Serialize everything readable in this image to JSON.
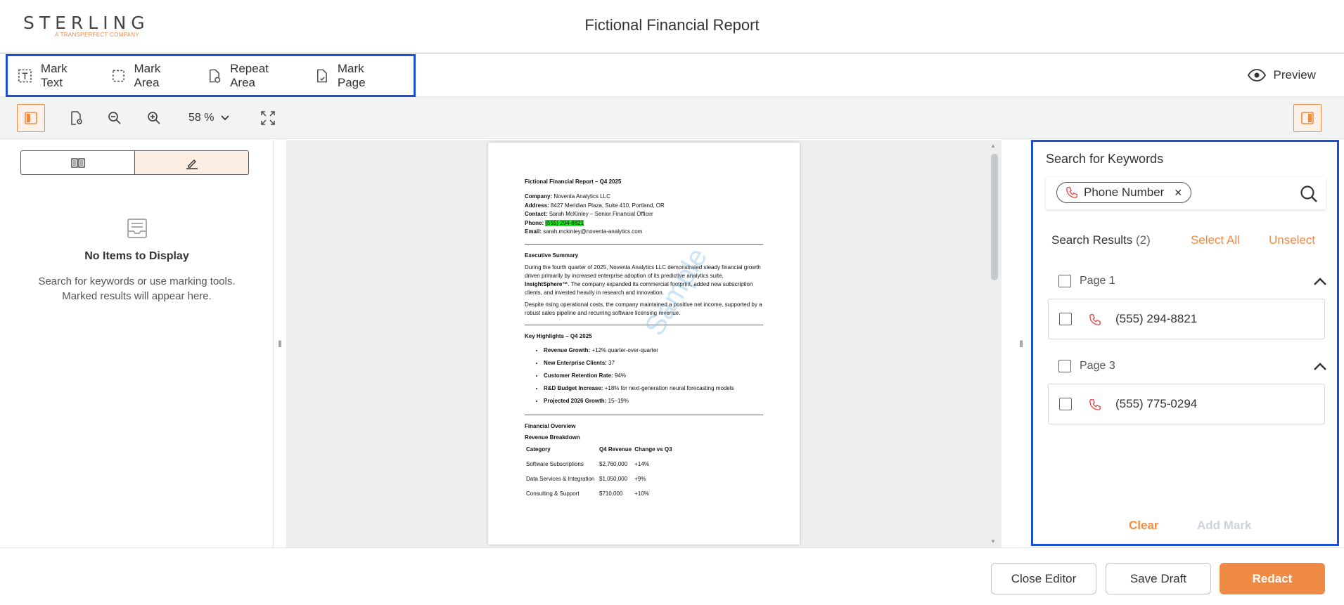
{
  "header": {
    "logo_text": "STERLING",
    "logo_sub": "A TRANSPERFECT COMPANY",
    "title": "Fictional Financial Report"
  },
  "toolbar": {
    "mark_text": "Mark Text",
    "mark_area": "Mark Area",
    "repeat_area": "Repeat Area",
    "mark_page": "Mark Page",
    "preview": "Preview"
  },
  "viewbar": {
    "zoom": "58 %"
  },
  "left_panel": {
    "empty_title": "No Items to Display",
    "empty_line1": "Search for keywords or use marking tools.",
    "empty_line2": "Marked results will appear here."
  },
  "document": {
    "title": "Fictional Financial Report – Q4 2025",
    "company_label": "Company:",
    "company": "Noventa Analytics LLC",
    "address_label": "Address:",
    "address": "8427 Meridian Plaza, Suite 410, Portland, OR",
    "contact_label": "Contact:",
    "contact": "Sarah McKinley – Senior Financial Officer",
    "phone_label": "Phone:",
    "phone": "(555) 294-8821",
    "email_label": "Email:",
    "email": "sarah.mckinley@noventa-analytics.com",
    "exec_heading": "Executive Summary",
    "exec_p1": "During the fourth quarter of 2025, Noventa Analytics LLC demonstrated steady financial growth driven primarily by increased enterprise adoption of its predictive analytics suite,",
    "exec_p1_bold": "InsightSphere™",
    "exec_p1_rest": ". The company expanded its commercial footprint, added new subscription clients, and invested heavily in research and innovation.",
    "exec_p2": "Despite rising operational costs, the company maintained a positive net income, supported by a robust sales pipeline and recurring software licensing revenue.",
    "highlights_heading": "Key Highlights – Q4 2025",
    "highlights": [
      {
        "label": "Revenue Growth:",
        "value": "+12% quarter-over-quarter"
      },
      {
        "label": "New Enterprise Clients:",
        "value": "37"
      },
      {
        "label": "Customer Retention Rate:",
        "value": "94%"
      },
      {
        "label": "R&D Budget Increase:",
        "value": "+18% for next-generation neural forecasting models"
      },
      {
        "label": "Projected 2026 Growth:",
        "value": "15–19%"
      }
    ],
    "financial_heading": "Financial Overview",
    "revenue_heading": "Revenue Breakdown",
    "table_headers": [
      "Category",
      "Q4 Revenue",
      "Change vs Q3"
    ],
    "table_rows": [
      [
        "Software Subscriptions",
        "$2,760,000",
        "+14%"
      ],
      [
        "Data Services & Integration",
        "$1,050,000",
        "+9%"
      ],
      [
        "Consulting & Support",
        "$710,000",
        "+10%"
      ]
    ],
    "watermark": "Sample"
  },
  "right_panel": {
    "title": "Search for Keywords",
    "chip_label": "Phone Number",
    "results_label": "Search Results",
    "results_count": "(2)",
    "select_all": "Select All",
    "unselect": "Unselect",
    "groups": [
      {
        "page": "Page 1",
        "value": "(555) 294-8821"
      },
      {
        "page": "Page 3",
        "value": "(555) 775-0294"
      }
    ],
    "clear": "Clear",
    "add_mark": "Add Mark"
  },
  "footer": {
    "close_editor": "Close Editor",
    "save_draft": "Save Draft",
    "redact": "Redact"
  },
  "colors": {
    "accent": "#ef8a45",
    "focus_border": "#1a4fd8",
    "highlight": "#22e522"
  }
}
